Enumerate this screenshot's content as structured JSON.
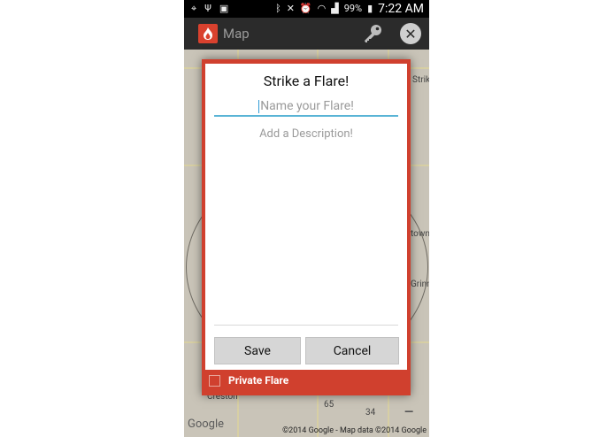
{
  "status_bar": {
    "battery": "99%",
    "time": "7:22 AM"
  },
  "action_bar": {
    "title": "Map"
  },
  "dialog": {
    "title": "Strike a Flare!",
    "name_placeholder": "Name your Flare!",
    "description_placeholder": "Add a Description!",
    "save_label": "Save",
    "cancel_label": "Cancel",
    "private_label": "Private Flare"
  },
  "map": {
    "labels": [
      "Strike",
      "town",
      "Grinnell",
      "Creston",
      "65",
      "34"
    ],
    "google_logo": "Google",
    "copyright": "©2014 Google - Map data ©2014 Google"
  },
  "colors": {
    "accent": "#d0402e",
    "field_underline": "#5ab4d6",
    "action_bar": "#2b2b2b"
  }
}
